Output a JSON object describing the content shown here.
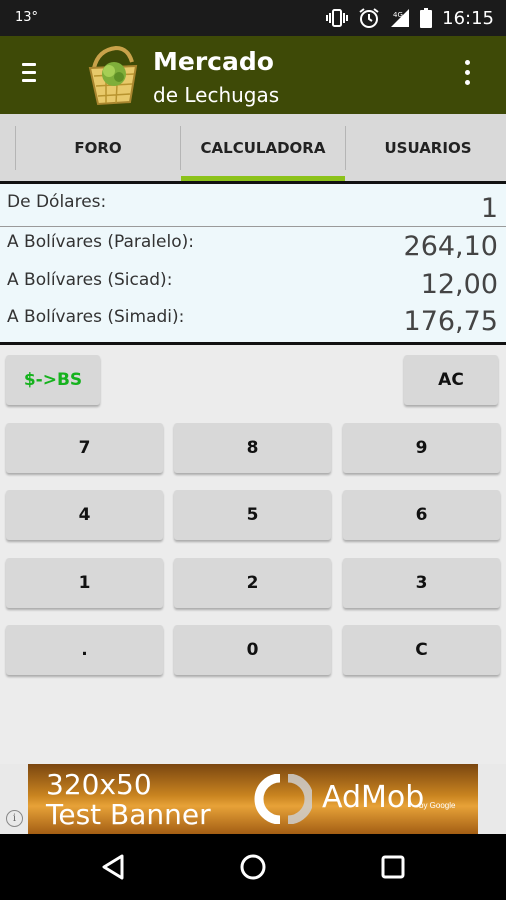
{
  "status_bar": {
    "left_text": "13°",
    "time": "16:15"
  },
  "app_bar": {
    "title": "Mercado",
    "subtitle": "de Lechugas"
  },
  "tabs": [
    {
      "label": "FORO",
      "selected": false
    },
    {
      "label": "CALCULADORA",
      "selected": true
    },
    {
      "label": "USUARIOS",
      "selected": false
    }
  ],
  "display": {
    "from_label": "De  Dólares:",
    "from_value": "1",
    "rates": [
      {
        "label": "A Bolívares (Paralelo):",
        "value": "264,10"
      },
      {
        "label": "A Bolívares (Sicad):",
        "value": "12,00"
      },
      {
        "label": "A Bolívares (Simadi):",
        "value": "176,75"
      }
    ]
  },
  "keypad": {
    "convert": "$->BS",
    "clear_all": "AC",
    "rows": [
      [
        "7",
        "8",
        "9"
      ],
      [
        "4",
        "5",
        "6"
      ],
      [
        "1",
        "2",
        "3"
      ],
      [
        ".",
        "0",
        "C"
      ]
    ]
  },
  "ad": {
    "line1": "320x50",
    "line2": "Test Banner",
    "brand": "AdMob",
    "by": "by Google",
    "info": "i"
  },
  "colors": {
    "app_bar": "#3e4a07",
    "tab_indicator": "#8cc21b",
    "convert_text": "#15b21d",
    "display_bg": "#eef8fb"
  },
  "icons": [
    "menu-icon",
    "overflow-icon",
    "vibrate-icon",
    "alarm-icon",
    "signal-icon",
    "battery-icon",
    "back-icon",
    "home-icon",
    "recents-icon",
    "basket-logo"
  ]
}
